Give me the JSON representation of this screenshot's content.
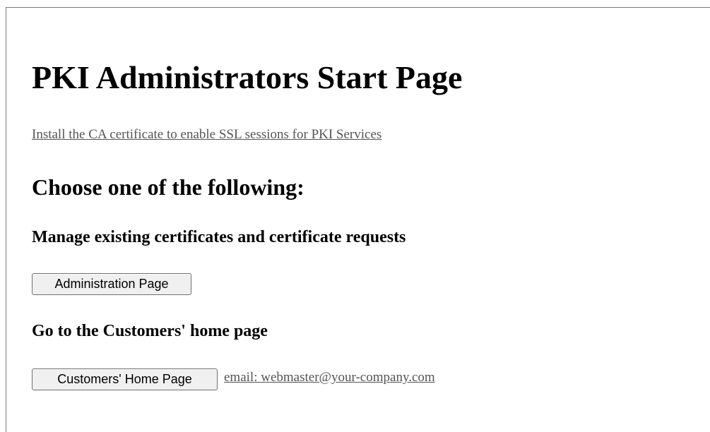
{
  "page": {
    "title": "PKI Administrators Start Page",
    "ca_link": "Install the CA certificate to enable SSL sessions for PKI Services",
    "choose_heading": "Choose one of the following:"
  },
  "sections": {
    "manage": {
      "heading": "Manage existing certificates and certificate requests",
      "button_label": "Administration Page"
    },
    "customers": {
      "heading": "Go to the Customers' home page",
      "button_label": "Customers' Home Page",
      "email_link": "email: webmaster@your-company.com"
    }
  }
}
